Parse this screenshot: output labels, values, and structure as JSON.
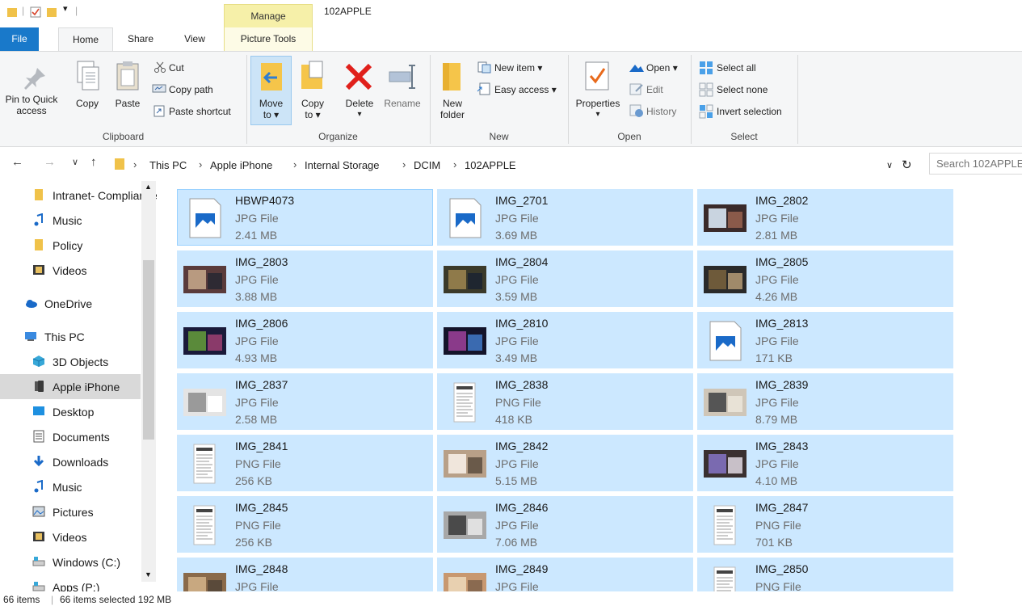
{
  "window": {
    "title": "102APPLE",
    "manage_tab": "Manage"
  },
  "tabs": [
    {
      "label": "File"
    },
    {
      "label": "Home"
    },
    {
      "label": "Share"
    },
    {
      "label": "View"
    },
    {
      "label": "Picture Tools"
    }
  ],
  "ribbon": {
    "clipboard": {
      "pin": [
        "Pin to Quick",
        "access"
      ],
      "copy": "Copy",
      "paste": "Paste",
      "cut": "Cut",
      "copy_path": "Copy path",
      "paste_shortcut": "Paste shortcut",
      "label": "Clipboard"
    },
    "organize": {
      "move": [
        "Move",
        "to ▾"
      ],
      "copy": [
        "Copy",
        "to ▾"
      ],
      "delete": "Delete",
      "rename": "Rename",
      "label": "Organize"
    },
    "new": {
      "folder": [
        "New",
        "folder"
      ],
      "new_item": "New item ▾",
      "easy_access": "Easy access ▾",
      "label": "New"
    },
    "open": {
      "properties": "Properties",
      "properties_arrow": "▾",
      "open": "Open ▾",
      "edit": "Edit",
      "history": "History",
      "label": "Open"
    },
    "select": {
      "select_all": "Select all",
      "select_none": "Select none",
      "invert": "Invert selection",
      "label": "Select"
    }
  },
  "address": {
    "crumbs": [
      "This PC",
      "Apple iPhone",
      "Internal Storage",
      "DCIM",
      "102APPLE"
    ],
    "search_placeholder": "Search 102APPLE"
  },
  "nav": [
    {
      "label": "Intranet- Compliance",
      "icon": "folder-icon"
    },
    {
      "label": "Music",
      "icon": "music-icon"
    },
    {
      "label": "Policy",
      "icon": "folder-icon"
    },
    {
      "label": "Videos",
      "icon": "videos-icon"
    },
    {
      "label": "OneDrive",
      "icon": "onedrive-icon"
    },
    {
      "label": "This PC",
      "icon": "this-pc-icon"
    },
    {
      "label": "3D Objects",
      "icon": "3d-objects-icon"
    },
    {
      "label": "Apple iPhone",
      "icon": "iphone-icon",
      "selected": true
    },
    {
      "label": "Desktop",
      "icon": "desktop-icon"
    },
    {
      "label": "Documents",
      "icon": "documents-icon"
    },
    {
      "label": "Downloads",
      "icon": "downloads-icon"
    },
    {
      "label": "Music",
      "icon": "music-icon"
    },
    {
      "label": "Pictures",
      "icon": "pictures-icon"
    },
    {
      "label": "Videos",
      "icon": "videos-icon"
    },
    {
      "label": "Windows  (C:)",
      "icon": "drive-icon"
    },
    {
      "label": "Apps (P:)",
      "icon": "drive-icon"
    }
  ],
  "files": [
    {
      "name": "HBWP4073",
      "type": "JPG File",
      "size": "2.41 MB",
      "thumb": "generic"
    },
    {
      "name": "IMG_2701",
      "type": "JPG File",
      "size": "3.69 MB",
      "thumb": "generic"
    },
    {
      "name": "IMG_2802",
      "type": "JPG File",
      "size": "2.81 MB",
      "thumb": "photo",
      "colors": [
        "#3a2a2a",
        "#c9d4e0",
        "#8a5a4a"
      ]
    },
    {
      "name": "IMG_2803",
      "type": "JPG File",
      "size": "3.88 MB",
      "thumb": "photo",
      "colors": [
        "#5a3b3b",
        "#b89a80",
        "#2e2a33"
      ]
    },
    {
      "name": "IMG_2804",
      "type": "JPG File",
      "size": "3.59 MB",
      "thumb": "photo",
      "colors": [
        "#3b3a2a",
        "#8f7a4a",
        "#1f2630"
      ]
    },
    {
      "name": "IMG_2805",
      "type": "JPG File",
      "size": "4.26 MB",
      "thumb": "photo",
      "colors": [
        "#2a2a2a",
        "#6e5a3a",
        "#a08a6a"
      ]
    },
    {
      "name": "IMG_2806",
      "type": "JPG File",
      "size": "4.93 MB",
      "thumb": "photo",
      "colors": [
        "#1a1a3a",
        "#5a8a3a",
        "#8a3a6a"
      ]
    },
    {
      "name": "IMG_2810",
      "type": "JPG File",
      "size": "3.49 MB",
      "thumb": "photo",
      "colors": [
        "#14142a",
        "#8a3a8a",
        "#3a6ab0"
      ]
    },
    {
      "name": "IMG_2813",
      "type": "JPG File",
      "size": "171 KB",
      "thumb": "generic"
    },
    {
      "name": "IMG_2837",
      "type": "JPG File",
      "size": "2.58 MB",
      "thumb": "photo",
      "colors": [
        "#e4e4e4",
        "#9a9a9a",
        "#ffffff"
      ]
    },
    {
      "name": "IMG_2838",
      "type": "PNG File",
      "size": "418 KB",
      "thumb": "doc"
    },
    {
      "name": "IMG_2839",
      "type": "JPG File",
      "size": "8.79 MB",
      "thumb": "photo",
      "colors": [
        "#cfc6b8",
        "#555555",
        "#e8e2d6"
      ]
    },
    {
      "name": "IMG_2841",
      "type": "PNG File",
      "size": "256 KB",
      "thumb": "doc"
    },
    {
      "name": "IMG_2842",
      "type": "JPG File",
      "size": "5.15 MB",
      "thumb": "photo",
      "colors": [
        "#b8a088",
        "#f0e6dc",
        "#6a5a4a"
      ]
    },
    {
      "name": "IMG_2843",
      "type": "JPG File",
      "size": "4.10 MB",
      "thumb": "photo",
      "colors": [
        "#3a3030",
        "#7a6ab0",
        "#c8c0c8"
      ]
    },
    {
      "name": "IMG_2845",
      "type": "PNG File",
      "size": "256 KB",
      "thumb": "doc"
    },
    {
      "name": "IMG_2846",
      "type": "JPG File",
      "size": "7.06 MB",
      "thumb": "photo",
      "colors": [
        "#a8a8a8",
        "#4a4a4a",
        "#e0e0e0"
      ]
    },
    {
      "name": "IMG_2847",
      "type": "PNG File",
      "size": "701 KB",
      "thumb": "doc"
    },
    {
      "name": "IMG_2848",
      "type": "JPG File",
      "size": "",
      "thumb": "photo",
      "colors": [
        "#8a6a4a",
        "#c8a880",
        "#5a4a3a"
      ]
    },
    {
      "name": "IMG_2849",
      "type": "JPG File",
      "size": "",
      "thumb": "photo",
      "colors": [
        "#c89870",
        "#e8d0b0",
        "#8a6a50"
      ]
    },
    {
      "name": "IMG_2850",
      "type": "PNG File",
      "size": "",
      "thumb": "doc"
    }
  ],
  "status": {
    "count": "66 items",
    "selected": "66 items selected  192 MB"
  }
}
